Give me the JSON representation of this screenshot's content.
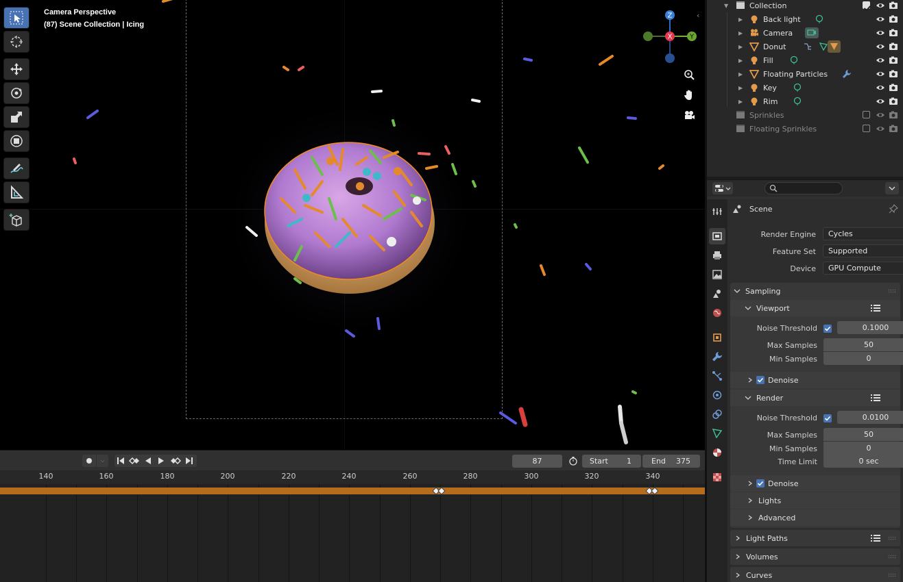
{
  "viewport": {
    "view_name": "Camera Perspective",
    "context": "(87) Scene Collection | Icing"
  },
  "timeline": {
    "current_frame": "87",
    "start_label": "Start",
    "start_value": "1",
    "end_label": "End",
    "end_value": "375",
    "ticks": [
      "140",
      "160",
      "180",
      "200",
      "220",
      "240",
      "260",
      "280",
      "300",
      "320",
      "340"
    ]
  },
  "outliner": {
    "collection": "Collection",
    "items": [
      {
        "label": "Back light",
        "type": "light"
      },
      {
        "label": "Camera",
        "type": "camera"
      },
      {
        "label": "Donut",
        "type": "mesh"
      },
      {
        "label": "Fill",
        "type": "light"
      },
      {
        "label": "Floating Particles",
        "type": "mesh"
      },
      {
        "label": "Key",
        "type": "light"
      },
      {
        "label": "Rim",
        "type": "light"
      }
    ],
    "excluded": [
      "Sprinkles",
      "Floating Sprinkles"
    ]
  },
  "properties": {
    "context_label": "Scene",
    "search_placeholder": "",
    "render_engine_label": "Render Engine",
    "render_engine_value": "Cycles",
    "feature_set_label": "Feature Set",
    "feature_set_value": "Supported",
    "device_label": "Device",
    "device_value": "GPU Compute",
    "sampling": {
      "title": "Sampling",
      "viewport": {
        "title": "Viewport",
        "noise_threshold_label": "Noise Threshold",
        "noise_threshold_value": "0.1000",
        "max_samples_label": "Max Samples",
        "max_samples_value": "50",
        "min_samples_label": "Min Samples",
        "min_samples_value": "0",
        "denoise_label": "Denoise"
      },
      "render": {
        "title": "Render",
        "noise_threshold_label": "Noise Threshold",
        "noise_threshold_value": "0.0100",
        "max_samples_label": "Max Samples",
        "max_samples_value": "50",
        "min_samples_label": "Min Samples",
        "min_samples_value": "0",
        "time_limit_label": "Time Limit",
        "time_limit_value": "0 sec",
        "denoise_label": "Denoise"
      },
      "lights_label": "Lights",
      "advanced_label": "Advanced"
    },
    "light_paths_label": "Light Paths",
    "volumes_label": "Volumes",
    "curves_label": "Curves"
  },
  "gizmo": {
    "x": "X",
    "y": "Y",
    "z": "Z"
  },
  "colors": {
    "accent": "#4772b3",
    "timeline_bar": "#b56c1d",
    "selection_outline": "#f28a1e"
  }
}
